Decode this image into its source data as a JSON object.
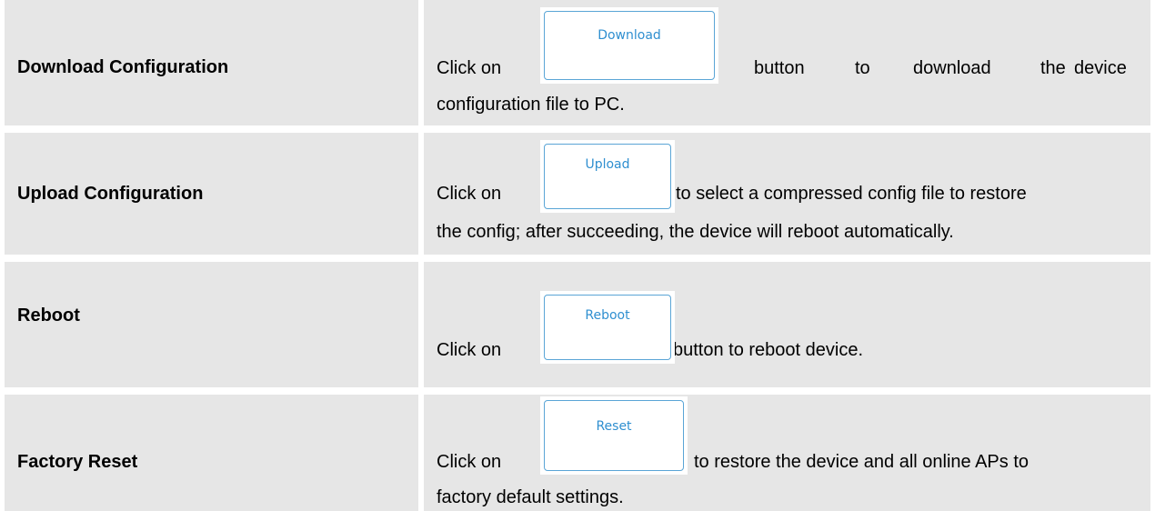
{
  "rows": [
    {
      "label": "Download Configuration",
      "prefix": "Click on",
      "button": "Download",
      "suffix_words": [
        "button",
        "to",
        "download",
        "the",
        "device"
      ],
      "line2": "configuration file to PC."
    },
    {
      "label": "Upload Configuration",
      "prefix": "Click on",
      "button": "Upload",
      "suffix": "to select a compressed config file to restore",
      "line2": "the config; after succeeding, the device will reboot automatically."
    },
    {
      "label": "Reboot",
      "prefix": "Click on",
      "button": "Reboot",
      "suffix": "button to reboot device."
    },
    {
      "label": "Factory Reset",
      "prefix": "Click on",
      "button": "Reset",
      "suffix": "to restore the device and all online APs to",
      "line2": "factory default settings."
    }
  ]
}
